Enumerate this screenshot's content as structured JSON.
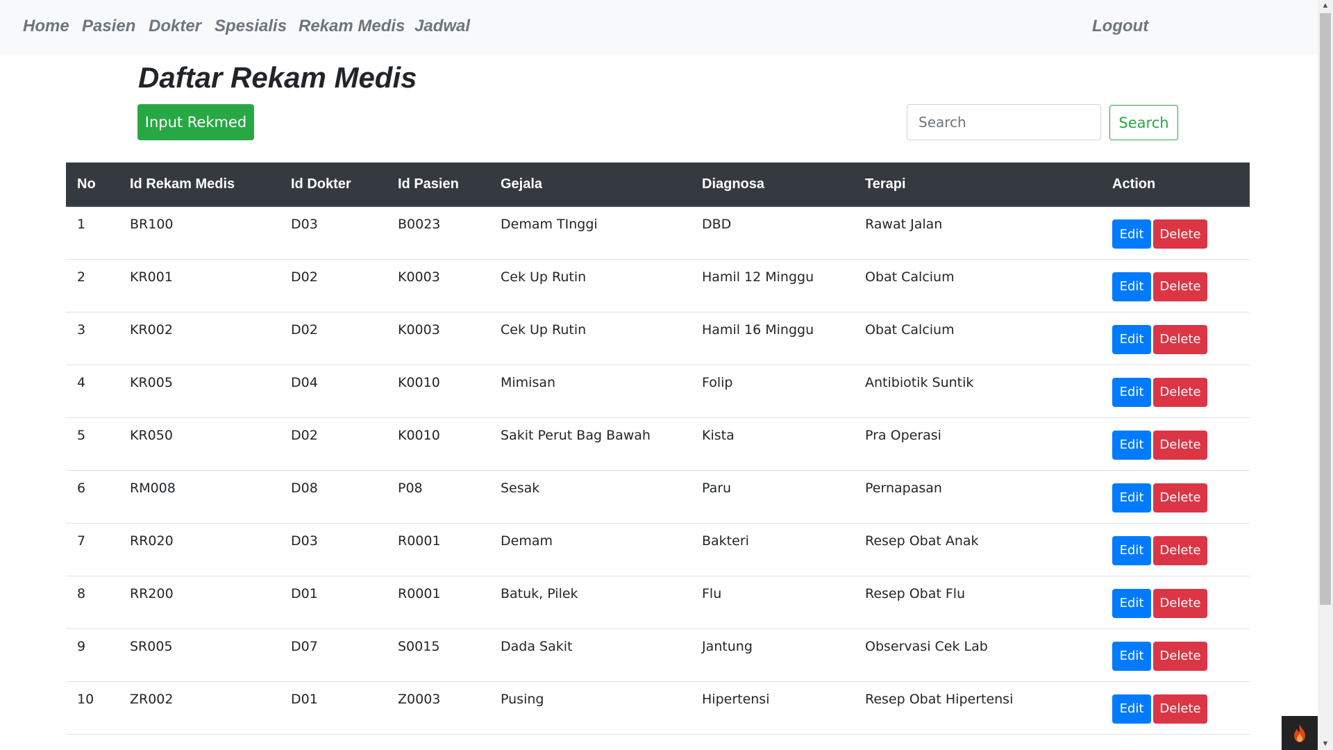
{
  "nav": {
    "items": [
      "Home",
      "Pasien",
      "Dokter",
      "Spesialis",
      "Rekam Medis",
      "Jadwal"
    ],
    "logout": "Logout"
  },
  "page": {
    "title": "Daftar Rekam Medis",
    "input_button": "Input Rekmed"
  },
  "search": {
    "placeholder": "Search",
    "button": "Search"
  },
  "table": {
    "headers": [
      "No",
      "Id Rekam Medis",
      "Id Dokter",
      "Id Pasien",
      "Gejala",
      "Diagnosa",
      "Terapi",
      "Action"
    ],
    "rows": [
      [
        "1",
        "BR100",
        "D03",
        "B0023",
        "Demam TInggi",
        "DBD",
        "Rawat Jalan"
      ],
      [
        "2",
        "KR001",
        "D02",
        "K0003",
        "Cek Up Rutin",
        "Hamil 12 Minggu",
        "Obat Calcium"
      ],
      [
        "3",
        "KR002",
        "D02",
        "K0003",
        "Cek Up Rutin",
        "Hamil 16 Minggu",
        "Obat Calcium"
      ],
      [
        "4",
        "KR005",
        "D04",
        "K0010",
        "Mimisan",
        "Folip",
        "Antibiotik Suntik"
      ],
      [
        "5",
        "KR050",
        "D02",
        "K0010",
        "Sakit Perut Bag Bawah",
        "Kista",
        "Pra Operasi"
      ],
      [
        "6",
        "RM008",
        "D08",
        "P08",
        "Sesak",
        "Paru",
        "Pernapasan"
      ],
      [
        "7",
        "RR020",
        "D03",
        "R0001",
        "Demam",
        "Bakteri",
        "Resep Obat Anak"
      ],
      [
        "8",
        "RR200",
        "D01",
        "R0001",
        "Batuk, Pilek",
        "Flu",
        "Resep Obat Flu"
      ],
      [
        "9",
        "SR005",
        "D07",
        "S0015",
        "Dada Sakit",
        "Jantung",
        "Observasi Cek Lab"
      ],
      [
        "10",
        "ZR002",
        "D01",
        "Z0003",
        "Pusing",
        "Hipertensi",
        "Resep Obat Hipertensi"
      ]
    ],
    "edit_label": "Edit",
    "delete_label": "Delete"
  },
  "colors": {
    "navbar_bg": "#f8f9fa",
    "nav_text": "#6c757d",
    "table_header_bg": "#343a40",
    "success": "#28a745",
    "primary": "#007bff",
    "danger": "#dc3545"
  },
  "icons": {
    "debug_toolbar": "flame-icon"
  }
}
